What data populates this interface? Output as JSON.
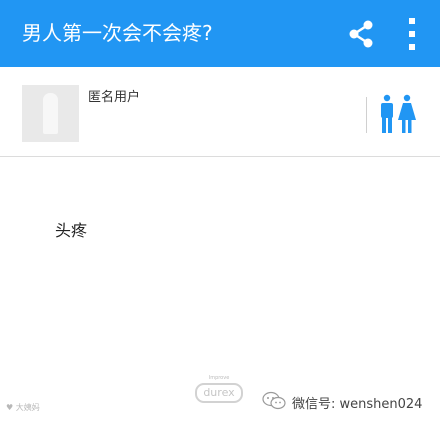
{
  "header": {
    "title": "男人第一次会不会疼?",
    "share_icon": "share-icon",
    "more_icon": "more-vertical-icon",
    "background": "#2196f3"
  },
  "question": {
    "author": "匿名用户",
    "avatar_icon": "avatar-placeholder",
    "gender_icon": "male-female-icon",
    "body": "头疼"
  },
  "footer": {
    "left_watermark": "大姨妈",
    "brand_small": "Improve",
    "brand": "durex",
    "wechat_icon": "wechat-icon",
    "wechat_id": "微信号: wenshen024"
  }
}
